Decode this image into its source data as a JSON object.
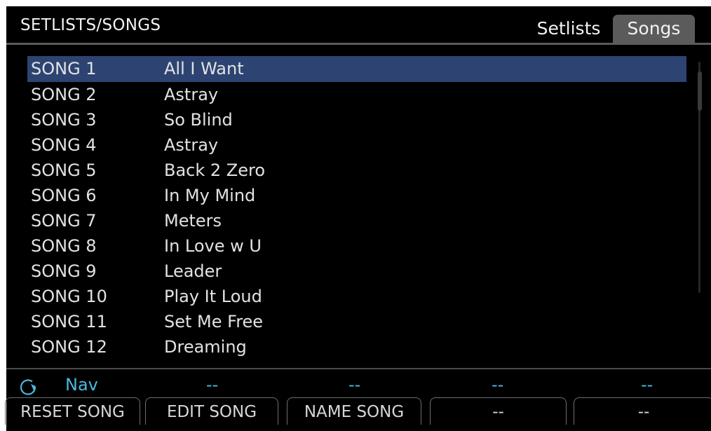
{
  "header": {
    "title": "SETLISTS/SONGS",
    "tabs": [
      {
        "label": "Setlists",
        "active": false
      },
      {
        "label": "Songs",
        "active": true
      }
    ]
  },
  "songs": [
    {
      "slot": "SONG 1",
      "name": "All I Want",
      "selected": true
    },
    {
      "slot": "SONG 2",
      "name": "Astray"
    },
    {
      "slot": "SONG 3",
      "name": "So Blind"
    },
    {
      "slot": "SONG 4",
      "name": "Astray"
    },
    {
      "slot": "SONG 5",
      "name": "Back 2 Zero"
    },
    {
      "slot": "SONG 6",
      "name": "In My Mind"
    },
    {
      "slot": "SONG 7",
      "name": "Meters"
    },
    {
      "slot": "SONG 8",
      "name": "In Love w U"
    },
    {
      "slot": "SONG 9",
      "name": "Leader"
    },
    {
      "slot": "SONG 10",
      "name": "Play It Loud"
    },
    {
      "slot": "SONG 11",
      "name": "Set Me Free"
    },
    {
      "slot": "SONG 12",
      "name": "Dreaming"
    }
  ],
  "nav": {
    "icon": "rotary-knob-icon",
    "label": "Nav",
    "values": [
      "--",
      "--",
      "--",
      "--"
    ]
  },
  "soft_buttons": [
    "RESET SONG",
    "EDIT SONG",
    "NAME SONG",
    "--",
    "--"
  ],
  "colors": {
    "background": "#000000",
    "selected_row": "#2d4472",
    "nav_accent": "#4ab8dc",
    "active_tab": "#5b5b5b"
  }
}
